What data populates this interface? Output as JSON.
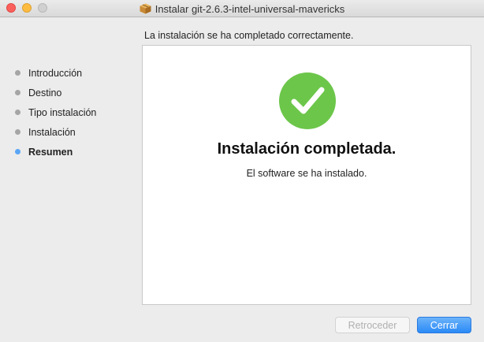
{
  "window": {
    "title": "Instalar git-2.6.3-intel-universal-mavericks",
    "title_icon": "package-icon"
  },
  "subtitle": "La instalación se ha completado correctamente.",
  "sidebar": {
    "steps": [
      {
        "label": "Introducción",
        "active": false
      },
      {
        "label": "Destino",
        "active": false
      },
      {
        "label": "Tipo instalación",
        "active": false
      },
      {
        "label": "Instalación",
        "active": false
      },
      {
        "label": "Resumen",
        "active": true
      }
    ]
  },
  "main": {
    "icon": "checkmark-icon",
    "headline": "Instalación completada.",
    "message": "El software se ha instalado."
  },
  "buttons": {
    "back_label": "Retroceder",
    "back_enabled": false,
    "close_label": "Cerrar"
  },
  "colors": {
    "accent": "#2a8af6",
    "success": "#6cc64a",
    "active_step_dot": "#5aa6f5"
  }
}
